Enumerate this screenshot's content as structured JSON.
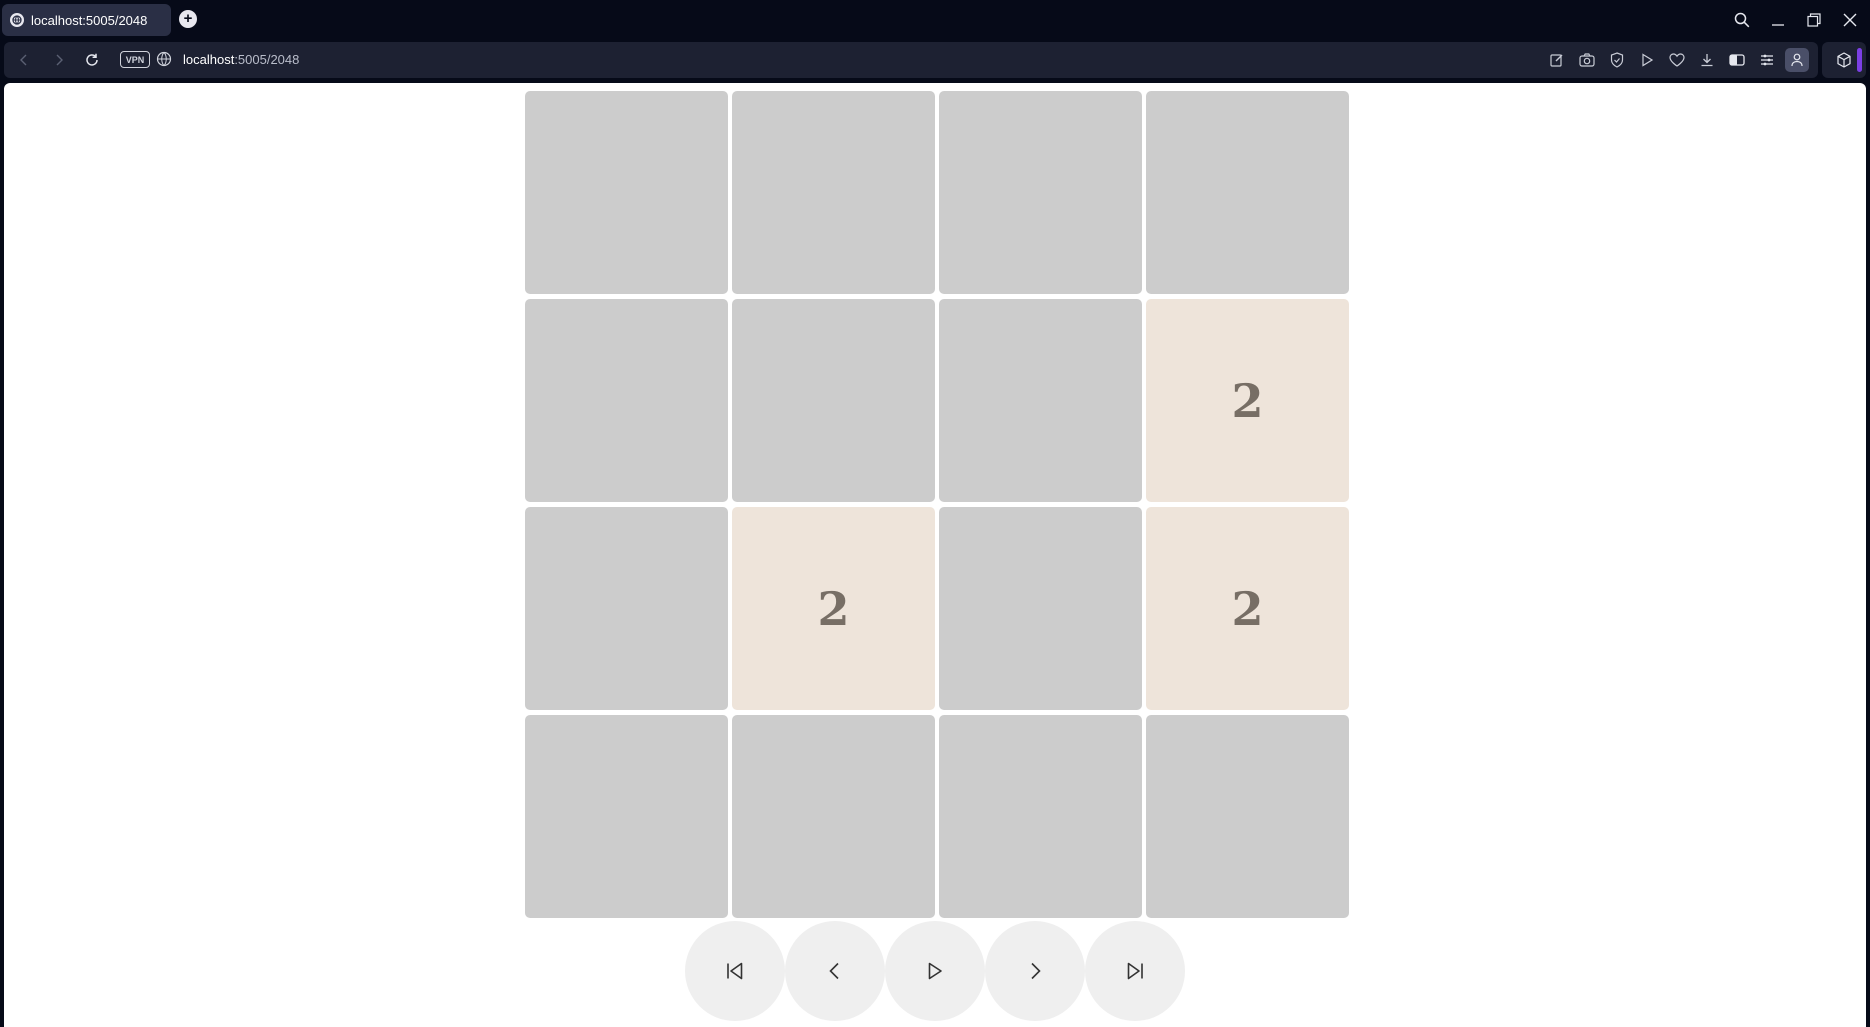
{
  "browser": {
    "tab_title": "localhost:5005/2048",
    "new_tab_symbol": "+",
    "vpn_label": "VPN",
    "url_host": "localhost",
    "url_path": ":5005/2048",
    "icons": {
      "back": "chevron-left-icon",
      "forward": "chevron-right-icon",
      "reload": "reload-icon",
      "search": "search-icon",
      "minimize": "minimize-icon",
      "restore": "restore-icon",
      "close": "close-icon"
    }
  },
  "game": {
    "board_size": 4,
    "colors": {
      "empty": "#cccccc",
      "tile_2": "#eee4da",
      "text": "#776e65",
      "button": "#efefef"
    },
    "cells": [
      "",
      "",
      "",
      "",
      "",
      "",
      "",
      "2",
      "",
      "2",
      "",
      "2",
      "",
      "",
      "",
      ""
    ],
    "controls": [
      {
        "name": "first-move-button",
        "icon": "skip-to-start-icon"
      },
      {
        "name": "previous-move-button",
        "icon": "chevron-left-icon"
      },
      {
        "name": "play-button",
        "icon": "play-icon"
      },
      {
        "name": "next-move-button",
        "icon": "chevron-right-icon"
      },
      {
        "name": "last-move-button",
        "icon": "skip-to-end-icon"
      }
    ]
  }
}
